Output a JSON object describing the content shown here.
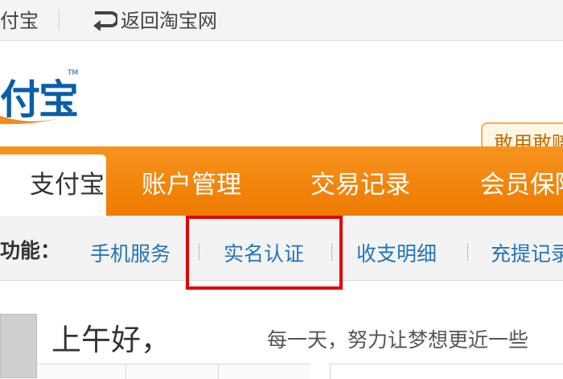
{
  "topbar": {
    "alipay_link": "付宝",
    "back_link": "返回淘宝网"
  },
  "logo": {
    "text": "付宝",
    "tm": "TM",
    "brand_color": "#0a5ea8"
  },
  "badge": {
    "text": "敢用敢赔"
  },
  "nav": {
    "tabs": [
      {
        "label": "支付宝",
        "active": true
      },
      {
        "label": "账户管理",
        "active": false
      },
      {
        "label": "交易记录",
        "active": false
      },
      {
        "label": "会员保障",
        "active": false
      }
    ],
    "accent": "#ee7b00"
  },
  "subnav": {
    "label": "功能：",
    "links": [
      "手机服务",
      "实名认证",
      "收支明细",
      "充提记录"
    ],
    "highlighted": "实名认证",
    "highlight_color": "#e30000"
  },
  "main": {
    "greeting": "上午好，",
    "motto": "每一天，努力让梦想更近一些"
  }
}
